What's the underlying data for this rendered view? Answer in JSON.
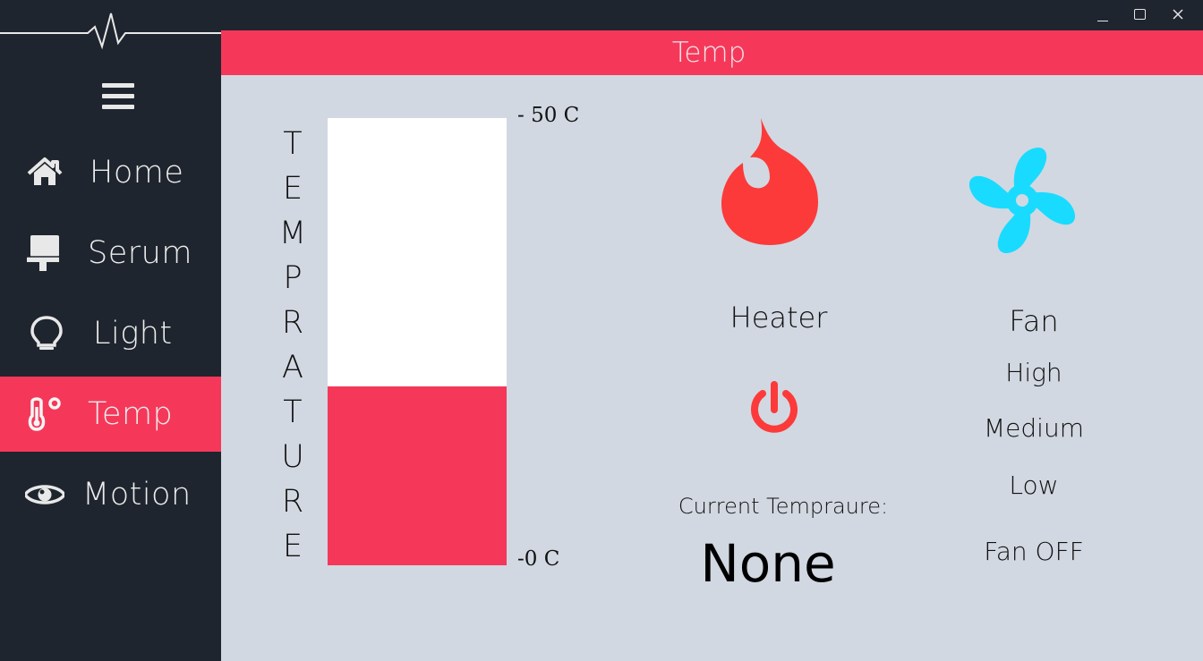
{
  "window": {
    "minimize": "minimize",
    "maximize": "maximize",
    "close": "close"
  },
  "sidebar": {
    "items": [
      {
        "label": "Home",
        "icon": "home-icon"
      },
      {
        "label": "Serum",
        "icon": "serum-icon"
      },
      {
        "label": "Light",
        "icon": "lightbulb-icon"
      },
      {
        "label": "Temp",
        "icon": "thermometer-icon",
        "active": true
      },
      {
        "label": "Motion",
        "icon": "eye-icon"
      }
    ]
  },
  "header": {
    "title": "Temp"
  },
  "gauge": {
    "label_letters": [
      "T",
      "E",
      "M",
      "P",
      "R",
      "A",
      "T",
      "U",
      "R",
      "E"
    ],
    "max_label": "- 50 C",
    "min_label": "-0 C",
    "fill_fraction": 0.4
  },
  "heater": {
    "label": "Heater"
  },
  "current": {
    "label": "Current Tempraure:",
    "value": "None"
  },
  "fan": {
    "label": "Fan",
    "high": "High",
    "medium": "Medium",
    "low": "Low",
    "off": "Fan OFF"
  },
  "colors": {
    "accent": "#f5385a",
    "sidebar": "#1f252e",
    "content": "#d1d8e1",
    "heater": "#fc3a3a",
    "fan": "#19dbff"
  }
}
